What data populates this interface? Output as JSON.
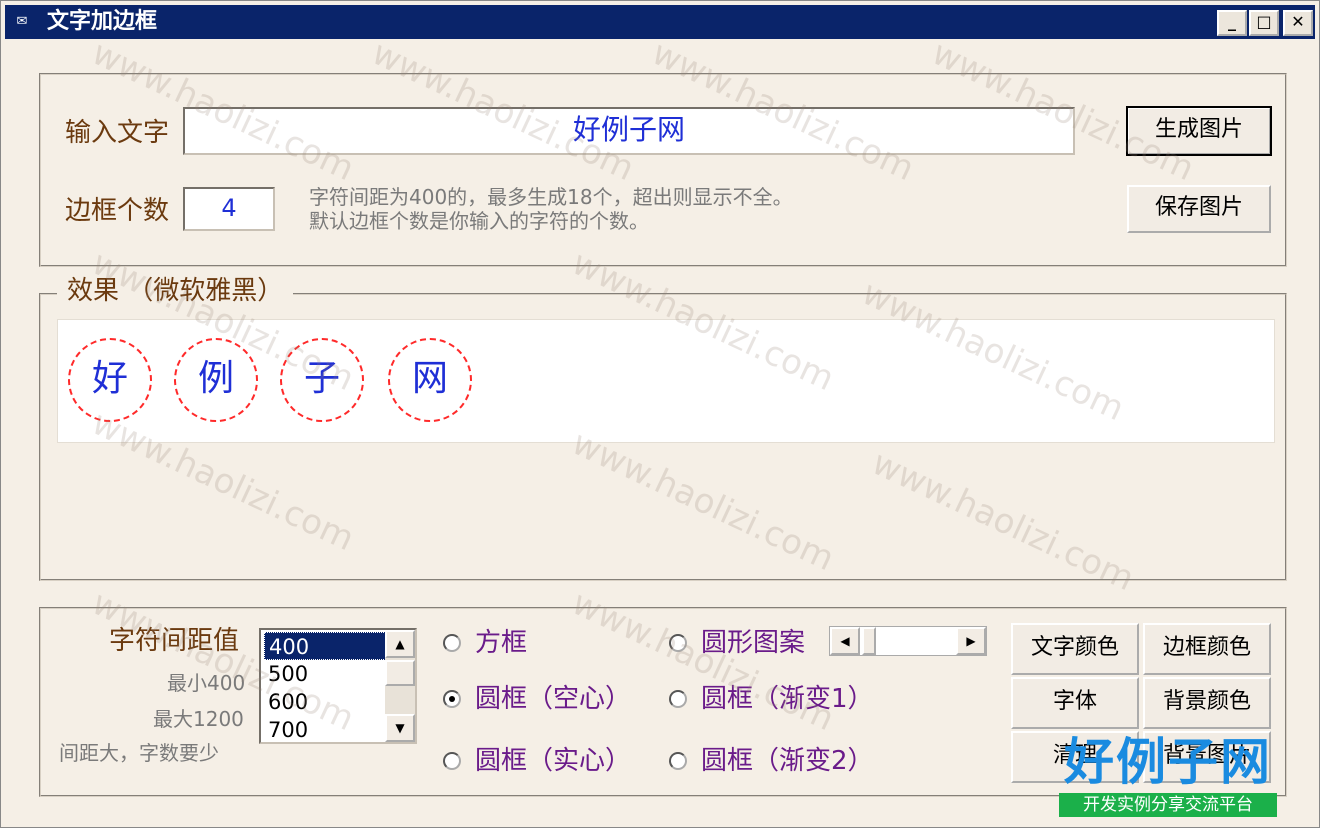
{
  "window": {
    "title": "文字加边框",
    "min_label": "_",
    "max_label": "□",
    "close_label": "✕"
  },
  "input_section": {
    "text_label": "输入文字",
    "text_value": "好例子网",
    "count_label": "边框个数",
    "count_value": "4",
    "hint_line1": "字符间距为400的，最多生成18个，超出则显示不全。",
    "hint_line2": "默认边框个数是你输入的字符的个数。",
    "generate_button": "生成图片",
    "save_button": "保存图片"
  },
  "effect": {
    "legend": "效果 （微软雅黑）",
    "chars": [
      "好",
      "例",
      "子",
      "网"
    ],
    "text_color": "#1f2fd6",
    "border_color": "#ff2a2a"
  },
  "settings": {
    "spacing_label": "字符间距值",
    "min_hint": "最小400",
    "max_hint": "最大1200",
    "note": "间距大，字数要少",
    "spacing_options": [
      "400",
      "500",
      "600",
      "700"
    ],
    "selected_spacing": "400",
    "radios": [
      {
        "label": "方框",
        "checked": false
      },
      {
        "label": "圆形图案",
        "checked": false
      },
      {
        "label": "圆框（空心）",
        "checked": true
      },
      {
        "label": "圆框（渐变1）",
        "checked": false
      },
      {
        "label": "圆框（实心）",
        "checked": false
      },
      {
        "label": "圆框（渐变2）",
        "checked": false
      }
    ],
    "buttons": [
      "文字颜色",
      "边框颜色",
      "字体",
      "背景颜色",
      "清理",
      "背景图片"
    ]
  },
  "watermark": {
    "text": "www.haolizi.com"
  },
  "logo": {
    "main": "好例子网",
    "sub": "开发实例分享交流平台"
  }
}
